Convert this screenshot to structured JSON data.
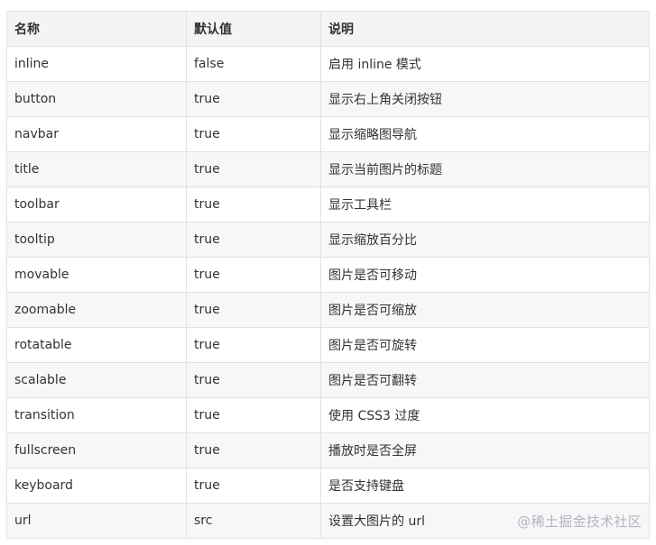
{
  "table": {
    "headers": [
      "名称",
      "默认值",
      "说明"
    ],
    "rows": [
      [
        "inline",
        "false",
        "启用 inline 模式"
      ],
      [
        "button",
        "true",
        "显示右上角关闭按钮"
      ],
      [
        "navbar",
        "true",
        "显示缩略图导航"
      ],
      [
        "title",
        "true",
        "显示当前图片的标题"
      ],
      [
        "toolbar",
        "true",
        "显示工具栏"
      ],
      [
        "tooltip",
        "true",
        "显示缩放百分比"
      ],
      [
        "movable",
        "true",
        "图片是否可移动"
      ],
      [
        "zoomable",
        "true",
        "图片是否可缩放"
      ],
      [
        "rotatable",
        "true",
        "图片是否可旋转"
      ],
      [
        "scalable",
        "true",
        "图片是否可翻转"
      ],
      [
        "transition",
        "true",
        "使用 CSS3 过度"
      ],
      [
        "fullscreen",
        "true",
        "播放时是否全屏"
      ],
      [
        "keyboard",
        "true",
        "是否支持键盘"
      ],
      [
        "url",
        "src",
        "设置大图片的 url"
      ]
    ]
  },
  "watermark": "@稀土掘金技术社区"
}
